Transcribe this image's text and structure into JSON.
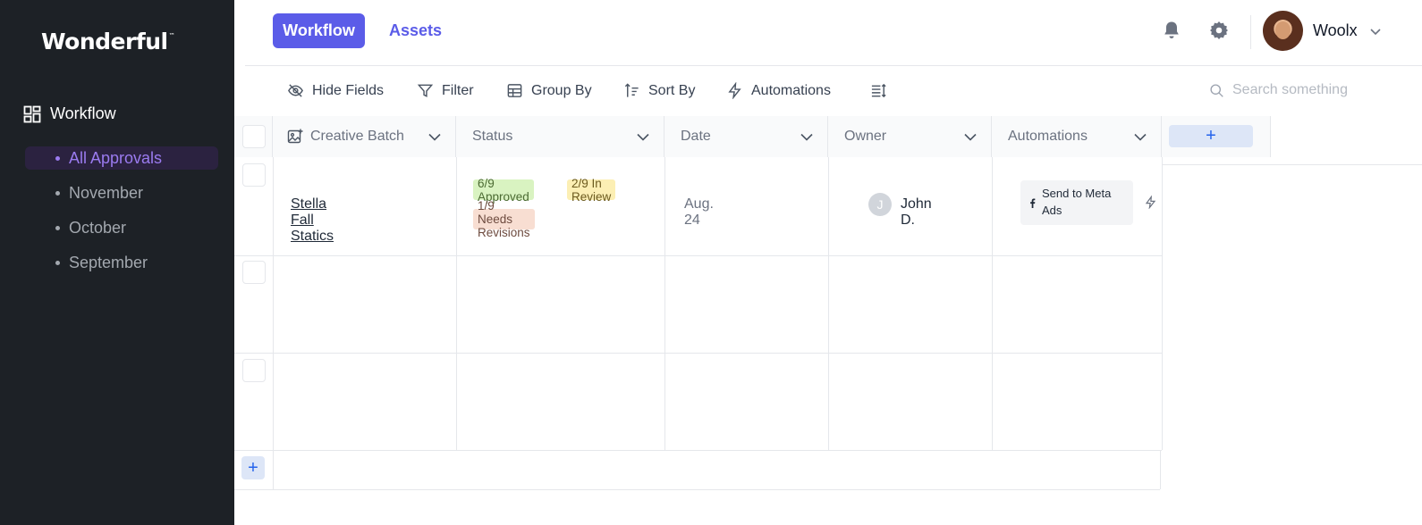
{
  "sidebar": {
    "brand": "Wonderful",
    "brand_mark": "™",
    "section_label": "Workflow",
    "items": [
      {
        "label": "All Approvals"
      },
      {
        "label": "November"
      },
      {
        "label": "October"
      },
      {
        "label": "September"
      }
    ]
  },
  "header": {
    "tabs": [
      {
        "label": "Workflow"
      },
      {
        "label": "Assets"
      }
    ],
    "user": {
      "name": "Woolx"
    }
  },
  "toolbar": {
    "hide_fields": "Hide Fields",
    "filter": "Filter",
    "group_by": "Group By",
    "sort_by": "Sort By",
    "automations": "Automations",
    "search_placeholder": "Search something"
  },
  "table": {
    "columns": [
      {
        "label": "Creative Batch"
      },
      {
        "label": "Status"
      },
      {
        "label": "Date"
      },
      {
        "label": "Owner"
      },
      {
        "label": "Automations"
      }
    ],
    "add_column_label": "+",
    "add_row_label": "+",
    "rows": [
      {
        "batch": "Stella Fall Statics",
        "status": [
          {
            "label": "6/9 Approved"
          },
          {
            "label": "2/9 In Review"
          },
          {
            "label": "1/9 Needs Revisions"
          }
        ],
        "date": "Aug. 24",
        "owner": {
          "initial": "J",
          "name": "John D."
        },
        "automation": "Send to Meta Ads"
      }
    ]
  },
  "colors": {
    "sidebar_bg": "#1d2126",
    "accent": "#5b5ce8",
    "active_item": "#9b7bf0",
    "approved_bg": "#d9f3c1",
    "review_bg": "#fcefb4",
    "revisions_bg": "#f8ded2"
  }
}
